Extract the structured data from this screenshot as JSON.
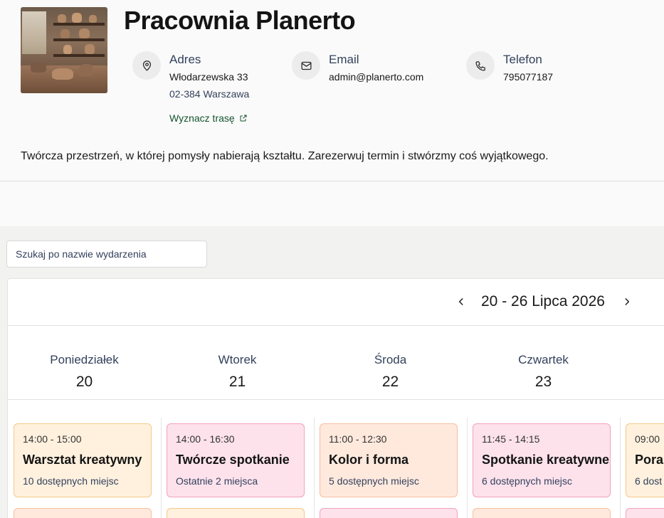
{
  "studio": {
    "title": "Pracownia Planerto",
    "description": "Twórcza przestrzeń, w której pomysły nabierają kształtu. Zarezerwuj termin i stwórzmy coś wyjątkowego."
  },
  "address": {
    "label": "Adres",
    "street": "Włodarzewska 33",
    "city": "02-384 Warszawa",
    "route_label": "Wyznacz trasę",
    "icon": "map-pin-icon"
  },
  "email": {
    "label": "Email",
    "value": "admin@planerto.com",
    "icon": "mail-icon"
  },
  "phone": {
    "label": "Telefon",
    "value": "795077187",
    "icon": "phone-icon"
  },
  "search": {
    "placeholder": "Szukaj po nazwie wydarzenia"
  },
  "calendar": {
    "range": "20 - 26 Lipca 2026",
    "days": [
      {
        "name": "Poniedziałek",
        "num": "20"
      },
      {
        "name": "Wtorek",
        "num": "21"
      },
      {
        "name": "Środa",
        "num": "22"
      },
      {
        "name": "Czwartek",
        "num": "23"
      }
    ],
    "events": [
      {
        "time": "14:00 - 15:00",
        "name": "Warsztat kreatywny",
        "availability": "10 dostępnych miejsc",
        "color": "orange"
      },
      {
        "time": "14:00 - 16:30",
        "name": "Twórcze spotkanie",
        "availability": "Ostatnie 2 miejsca",
        "color": "pink"
      },
      {
        "time": "11:00 - 12:30",
        "name": "Kolor i forma",
        "availability": "5 dostępnych miejsc",
        "color": "peach"
      },
      {
        "time": "11:45 - 14:15",
        "name": "Spotkanie kreatywne",
        "availability": "6 dostępnych miejsc",
        "color": "pink"
      },
      {
        "time": "09:00",
        "name": "Poran",
        "availability": "6 dost",
        "color": "orange"
      }
    ]
  },
  "colors": {
    "accent_green": "#14532d",
    "event_orange_bg": "#fff1de",
    "event_pink_bg": "#fde2ec",
    "event_peach_bg": "#ffe9dd"
  }
}
